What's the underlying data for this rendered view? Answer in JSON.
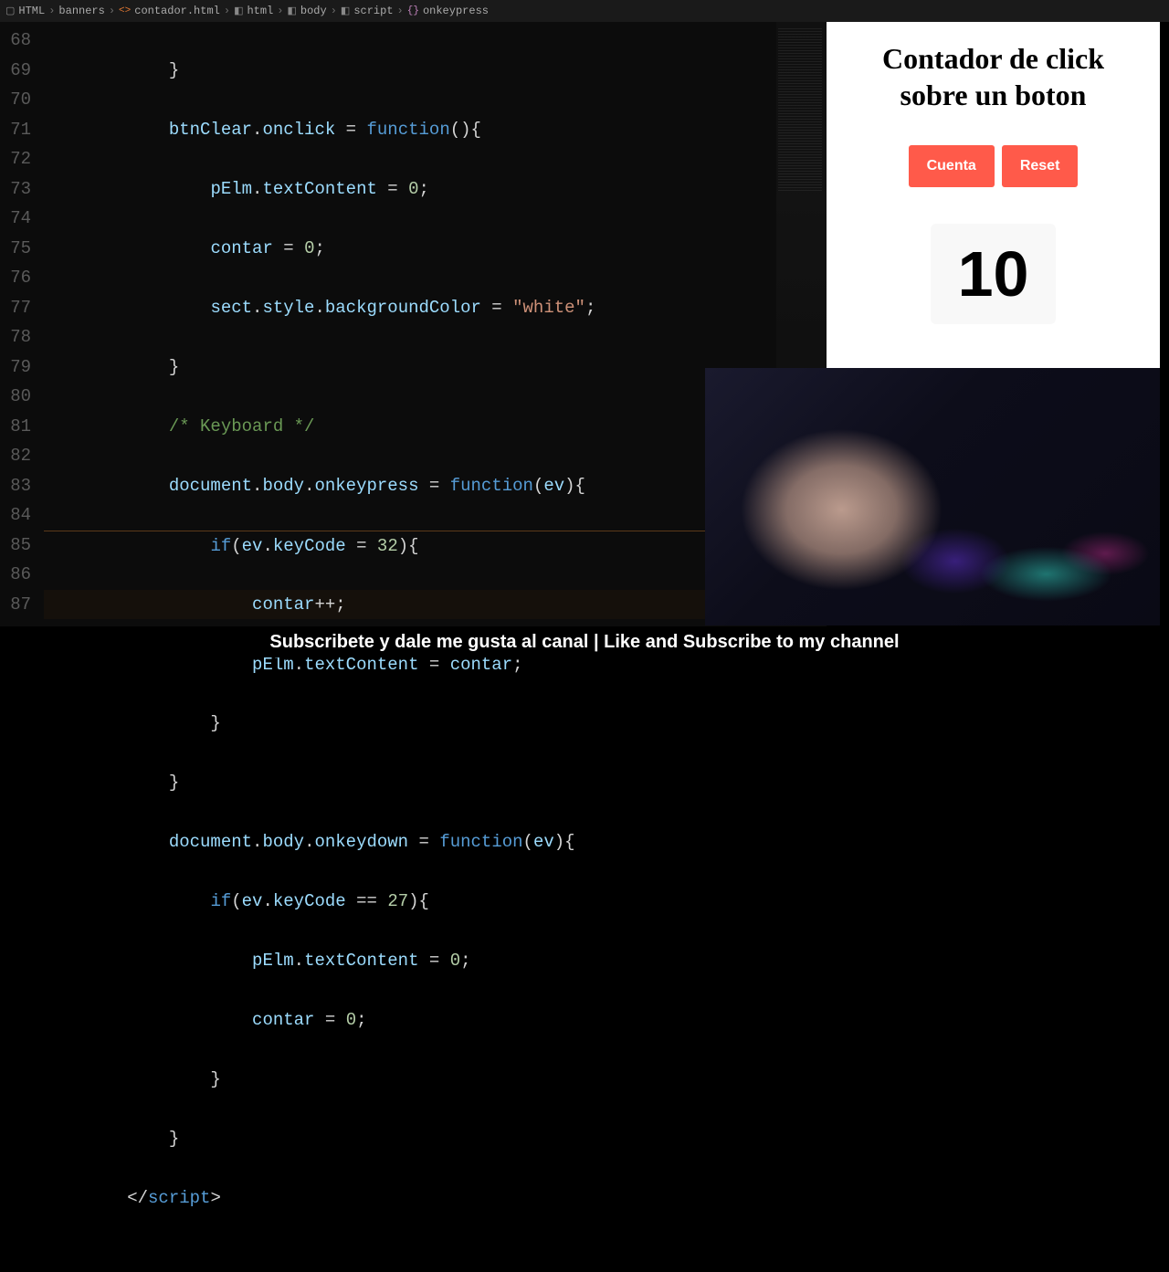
{
  "breadcrumb": [
    {
      "label": "HTML",
      "icon": "folder"
    },
    {
      "label": "banners",
      "icon": "folder"
    },
    {
      "label": "contador.html",
      "icon": "file"
    },
    {
      "label": "html",
      "icon": "tag"
    },
    {
      "label": "body",
      "icon": "tag"
    },
    {
      "label": "script",
      "icon": "tag"
    },
    {
      "label": "onkeypress",
      "icon": "brace"
    }
  ],
  "lines": {
    "start": 68,
    "end": 87
  },
  "preview": {
    "title": "Contador de click sobre un boton",
    "btn_cuenta": "Cuenta",
    "btn_reset": "Reset",
    "count": "10"
  },
  "footer": "Subscribete y dale me gusta al canal | Like and Subscribe to my channel",
  "code": {
    "l68": "            }",
    "l69a": "btnClear",
    "l69b": ".",
    "l69c": "onclick",
    "l69d": " = ",
    "l69e": "function",
    "l69f": "(){",
    "l70a": "pElm",
    "l70b": ".",
    "l70c": "textContent",
    "l70d": " = ",
    "l70e": "0",
    "l70f": ";",
    "l71a": "contar",
    "l71b": " = ",
    "l71c": "0",
    "l71d": ";",
    "l72a": "sect",
    "l72b": ".",
    "l72c": "style",
    "l72d": ".",
    "l72e": "backgroundColor",
    "l72f": " = ",
    "l72g": "\"white\"",
    "l72h": ";",
    "l73": "            }",
    "l74": "/* Keyboard */",
    "l75a": "document",
    "l75b": ".",
    "l75c": "body",
    "l75d": ".",
    "l75e": "onkeypress",
    "l75f": " = ",
    "l75g": "function",
    "l75h": "(",
    "l75i": "ev",
    "l75j": "){",
    "l76a": "if",
    "l76b": "(",
    "l76c": "ev",
    "l76d": ".",
    "l76e": "keyCode",
    "l76f": " = ",
    "l76g": "32",
    "l76h": "){",
    "l77a": "contar",
    "l77b": "++;",
    "l78a": "pElm",
    "l78b": ".",
    "l78c": "textContent",
    "l78d": " = ",
    "l78e": "contar",
    "l78f": ";",
    "l79": "                }",
    "l80": "            }",
    "l81a": "document",
    "l81b": ".",
    "l81c": "body",
    "l81d": ".",
    "l81e": "onkeydown",
    "l81f": " = ",
    "l81g": "function",
    "l81h": "(",
    "l81i": "ev",
    "l81j": "){",
    "l82a": "if",
    "l82b": "(",
    "l82c": "ev",
    "l82d": ".",
    "l82e": "keyCode",
    "l82f": " == ",
    "l82g": "27",
    "l82h": "){",
    "l83a": "pElm",
    "l83b": ".",
    "l83c": "textContent",
    "l83d": " = ",
    "l83e": "0",
    "l83f": ";",
    "l84a": "contar",
    "l84b": " = ",
    "l84c": "0",
    "l84d": ";",
    "l85": "                }",
    "l86": "            }",
    "l87a": "</",
    "l87b": "script",
    "l87c": ">"
  }
}
